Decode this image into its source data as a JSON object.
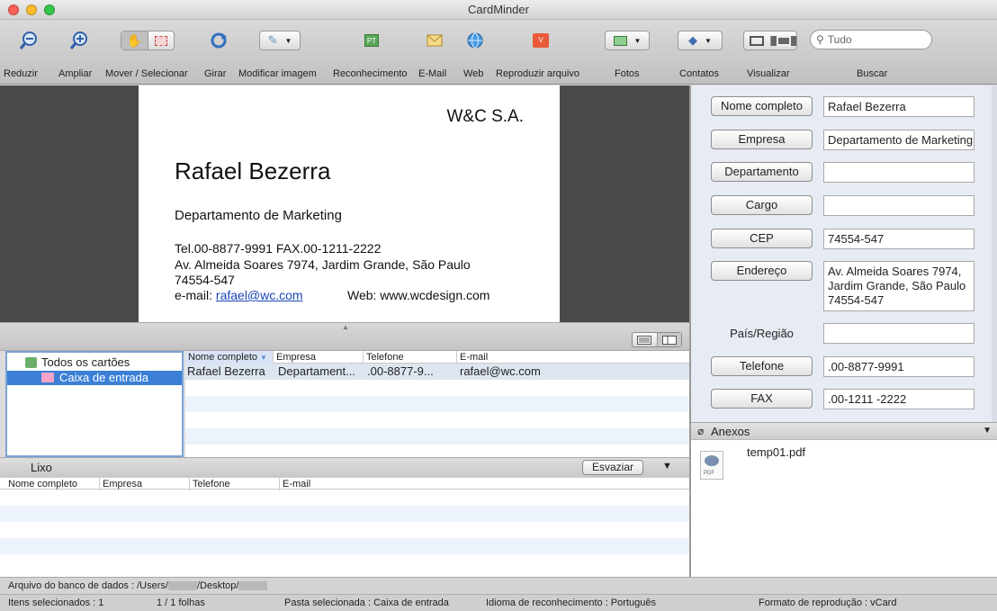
{
  "window": {
    "title": "CardMinder"
  },
  "toolbar": {
    "labels": {
      "zoom_out": "Reduzir",
      "zoom_in": "Ampliar",
      "move_select": "Mover / Selecionar",
      "rotate": "Girar",
      "modify_image": "Modificar imagem",
      "recognition": "Reconhecimento",
      "email": "E-Mail",
      "web": "Web",
      "play_file": "Reproduzir arquivo",
      "photos": "Fotos",
      "contacts": "Contatos",
      "view": "Visualizar",
      "search": "Buscar"
    },
    "search_placeholder": "Tudo"
  },
  "card_image": {
    "company": "W&C S.A.",
    "name": "Rafael Bezerra",
    "department": "Departamento de Marketing",
    "tel_fax": "Tel.00-8877-9991   FAX.00-1211-2222",
    "address_line1": "Av. Almeida Soares 7974, Jardim Grande, São Paulo",
    "address_line2": "74554-547",
    "email_prefix": "e-mail: ",
    "email": "rafael@wc.com",
    "web": "Web: www.wcdesign.com"
  },
  "folders": {
    "all_cards": "Todos os cartões",
    "inbox": "Caixa de entrada"
  },
  "card_list": {
    "columns": [
      "Nome completo",
      "Empresa",
      "Telefone",
      "E-mail"
    ],
    "rows": [
      {
        "name": "Rafael Bezerra",
        "company": "Departament...",
        "phone": ".00-8877-9...",
        "email": "rafael@wc.com"
      }
    ]
  },
  "trash": {
    "title": "Lixo",
    "empty_button": "Esvaziar",
    "columns": [
      "Nome completo",
      "Empresa",
      "Telefone",
      "E-mail"
    ]
  },
  "fields": [
    {
      "label": "Nome completo",
      "value": "Rafael Bezerra"
    },
    {
      "label": "Empresa",
      "value": "Departamento de Marketing"
    },
    {
      "label": "Departamento",
      "value": ""
    },
    {
      "label": "Cargo",
      "value": ""
    },
    {
      "label": "CEP",
      "value": "74554-547"
    },
    {
      "label": "Endereço",
      "value": "Av. Almeida Soares 7974, Jardim Grande, São Paulo 74554-547"
    },
    {
      "label": "País/Região",
      "value": ""
    },
    {
      "label": "Telefone",
      "value": ".00-8877-9991"
    },
    {
      "label": "FAX",
      "value": ".00-1211 -2222"
    }
  ],
  "attachments": {
    "title": "Anexos",
    "file_name": "temp01.pdf",
    "file_type": "PDF"
  },
  "db_path": {
    "prefix": "Arquivo do banco de dados : /Users/",
    "middle": "/Desktop/"
  },
  "status": {
    "selected_items": "Itens selecionados : 1",
    "pages": "1 / 1 folhas",
    "selected_folder": "Pasta selecionada : Caixa de entrada",
    "recognition_language": "Idioma de reconhecimento : Português",
    "play_format": "Formato de reprodução : vCard"
  }
}
